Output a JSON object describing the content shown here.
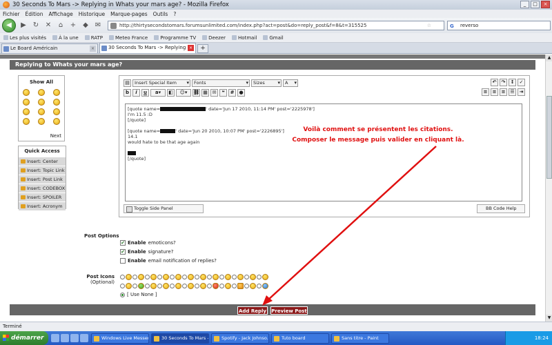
{
  "window": {
    "title": "30 Seconds To Mars -> Replying in Whats your mars age? - Mozilla Firefox"
  },
  "menu": [
    "Fichier",
    "Édition",
    "Affichage",
    "Historique",
    "Marque-pages",
    "Outils",
    "?"
  ],
  "nav": {
    "url": "http://thirtysecondstomars.forumsunlimited.com/index.php?act=post&do=reply_post&f=8&t=315525",
    "search": "reverso"
  },
  "bookmarks": [
    "Les plus visités",
    "À la une",
    "RATP",
    "Meteo France",
    "Programme TV",
    "Deezer",
    "Hotmail",
    "Gmail"
  ],
  "tabs": [
    {
      "label": "Le Board Américain"
    },
    {
      "label": "30 Seconds To Mars -> Replying i..."
    }
  ],
  "page": {
    "section_title": "Replying to Whats your mars age?",
    "side": {
      "show_all": "Show All",
      "next": "Next"
    },
    "quick_access": {
      "title": "Quick Access",
      "items": [
        "Insert: Center",
        "Insert: Topic Link",
        "Insert: Post Link",
        "Insert: CODEBOX",
        "Insert: SPOILER",
        "Insert: Acronym"
      ]
    },
    "toolbar": {
      "special": "Insert Special Item",
      "fonts": "Fonts",
      "sizes": "Sizes",
      "bold": "b",
      "italic": "i",
      "underline": "u"
    },
    "editor_lines": {
      "l1a": "[quote name=",
      "l1b": "' date='Jun 17 2010, 11:14 PM' post='2225978']",
      "l2": "I'm 11.5 :D",
      "l3": "[/quote]",
      "l4a": "[quote name=",
      "l4b": "' date='Jun 20 2010, 10:07 PM' post='2226895']",
      "l5": "14.1",
      "l6": "would hate to be that age again",
      "l7": "[/quote]"
    },
    "annotation": {
      "line1": "Voilà comment se présentent les citations.",
      "line2": "Composer le message puis valider en cliquant là."
    },
    "toggle_panel": "Toggle Side Panel",
    "bb_help": "BB Code Help",
    "post_options": {
      "title": "Post Options",
      "emoticons": {
        "bold": "Enable",
        "rest": " emoticons?"
      },
      "signature": {
        "bold": "Enable",
        "rest": " signature?"
      },
      "email": {
        "bold": "Enable",
        "rest": " email notification of replies?"
      }
    },
    "post_icons": {
      "title": "Post Icons",
      "sub": "(Optional)",
      "use_none": "[ Use None ]"
    },
    "buttons": {
      "add_reply": "Add Reply",
      "preview": "Preview Post"
    }
  },
  "status": "Terminé",
  "taskbar": {
    "start": "démarrer",
    "tasks": [
      "Windows Live Messen...",
      "30 Seconds To Mars -...",
      "Spotify - Jack Johnso...",
      "Tuto board",
      "Sans titre - Paint"
    ],
    "clock": "18:24"
  }
}
